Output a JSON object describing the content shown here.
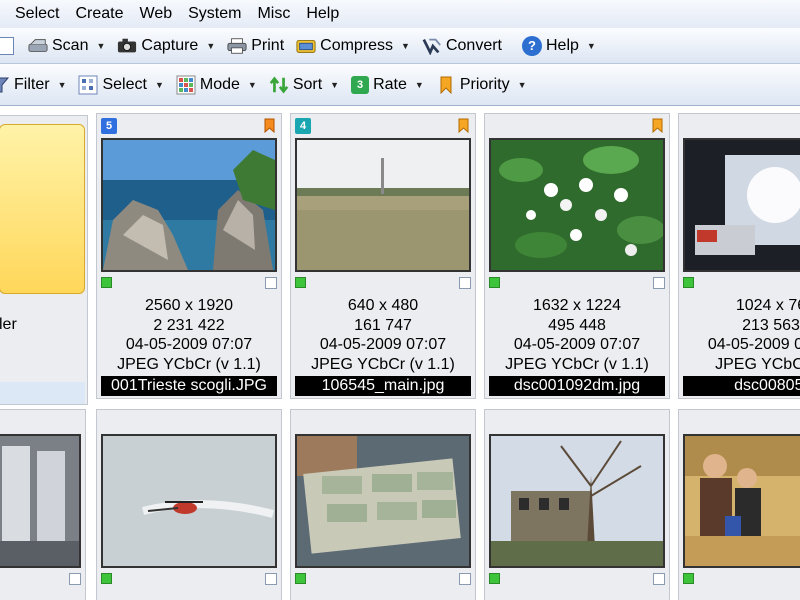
{
  "menubar": {
    "items": [
      "Select",
      "Create",
      "Web",
      "System",
      "Misc",
      "Help"
    ]
  },
  "toolbar1": {
    "buttons": [
      {
        "label": "Scan",
        "icon": "scanner-icon",
        "dropdown": true
      },
      {
        "label": "Capture",
        "icon": "camera-icon",
        "dropdown": true
      },
      {
        "label": "Print",
        "icon": "printer-icon",
        "dropdown": false
      },
      {
        "label": "Compress",
        "icon": "compress-icon",
        "dropdown": true
      },
      {
        "label": "Convert",
        "icon": "convert-icon",
        "dropdown": false
      },
      {
        "label": "Help",
        "icon": "help-icon",
        "dropdown": true
      }
    ]
  },
  "toolbar2": {
    "buttons": [
      {
        "label": "Filter",
        "icon": "filter-icon",
        "dropdown": true
      },
      {
        "label": "Select",
        "icon": "select-icon",
        "dropdown": true
      },
      {
        "label": "Mode",
        "icon": "mode-icon",
        "dropdown": true
      },
      {
        "label": "Sort",
        "icon": "sort-icon",
        "dropdown": true
      },
      {
        "label": "Rate",
        "icon": "rate-icon",
        "badge": "3",
        "dropdown": true
      },
      {
        "label": "Priority",
        "icon": "priority-icon",
        "dropdown": true
      }
    ]
  },
  "folder": {
    "label": "ler"
  },
  "thumbnails": [
    {
      "rating": "5",
      "rating_color": "#2f6fe0",
      "bookmarked": true,
      "scene": "sea-rocks",
      "dimensions": "2560 x 1920",
      "size": "2 231 422",
      "date": "04-05-2009  07:07",
      "format": "JPEG YCbCr (v 1.1)",
      "filename": "001Trieste scogli.JPG"
    },
    {
      "rating": "4",
      "rating_color": "#1aa6b0",
      "bookmarked": true,
      "scene": "field",
      "dimensions": "640 x 480",
      "size": "161 747",
      "date": "04-05-2009  07:07",
      "format": "JPEG YCbCr (v 1.1)",
      "filename": "106545_main.jpg"
    },
    {
      "rating": "",
      "rating_color": "",
      "bookmarked": true,
      "scene": "flowers",
      "dimensions": "1632 x 1224",
      "size": "495 448",
      "date": "04-05-2009  07:07",
      "format": "JPEG YCbCr (v 1.1)",
      "filename": "dsc001092dm.jpg"
    },
    {
      "rating": "",
      "rating_color": "",
      "bookmarked": false,
      "scene": "screen",
      "dimensions": "1024 x 76",
      "size": "213 563",
      "date": "04-05-2009  07:07",
      "format": "JPEG YCbCr (v",
      "filename": "dsc00805."
    },
    {
      "rating": "",
      "rating_color": "",
      "bookmarked": false,
      "scene": "seats",
      "dimensions": "",
      "size": "",
      "date": "",
      "format": "",
      "filename": ""
    },
    {
      "rating": "",
      "rating_color": "",
      "bookmarked": false,
      "scene": "helicopter",
      "dimensions": "",
      "size": "",
      "date": "",
      "format": "",
      "filename": ""
    },
    {
      "rating": "",
      "rating_color": "",
      "bookmarked": false,
      "scene": "money",
      "dimensions": "",
      "size": "",
      "date": "",
      "format": "",
      "filename": ""
    },
    {
      "rating": "",
      "rating_color": "",
      "bookmarked": false,
      "scene": "house",
      "dimensions": "",
      "size": "",
      "date": "",
      "format": "",
      "filename": ""
    },
    {
      "rating": "",
      "rating_color": "",
      "bookmarked": false,
      "scene": "people",
      "dimensions": "",
      "size": "",
      "date": "",
      "format": "",
      "filename": ""
    }
  ]
}
